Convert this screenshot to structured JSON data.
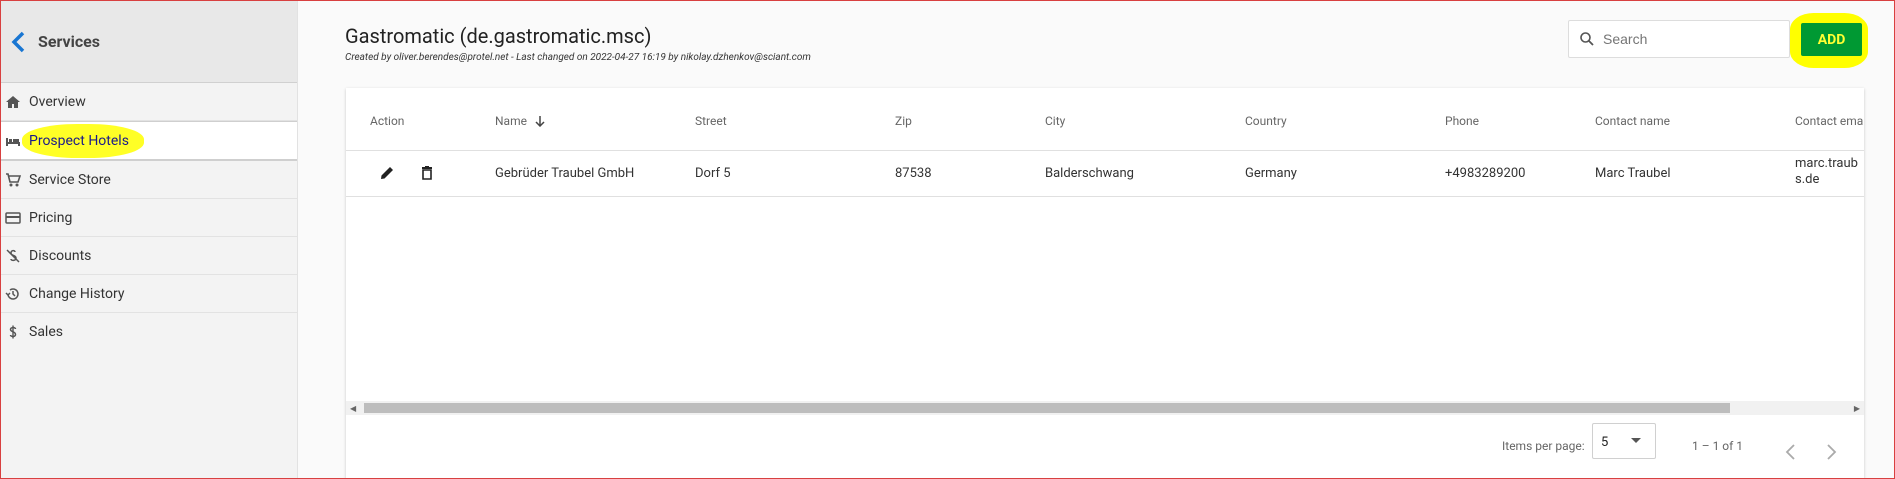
{
  "sidebar": {
    "title": "Services",
    "items": [
      {
        "label": "Overview"
      },
      {
        "label": "Prospect Hotels"
      },
      {
        "label": "Service Store"
      },
      {
        "label": "Pricing"
      },
      {
        "label": "Discounts"
      },
      {
        "label": "Change History"
      },
      {
        "label": "Sales"
      }
    ]
  },
  "header": {
    "title": "Gastromatic (de.gastromatic.msc)",
    "subtitle": "Created by oliver.berendes@protel.net - Last changed on 2022-04-27 16:19 by nikolay.dzhenkov@sciant.com",
    "search_placeholder": "Search",
    "add_label": "ADD"
  },
  "table": {
    "columns": [
      "Action",
      "Name",
      "Street",
      "Zip",
      "City",
      "Country",
      "Phone",
      "Contact name",
      "Contact ema"
    ],
    "rows": [
      {
        "name": "Gebrüder Traubel GmbH",
        "street": "Dorf 5",
        "zip": "87538",
        "city": "Balderschwang",
        "country": "Germany",
        "phone": "+4983289200",
        "contact_name": "Marc Traubel",
        "contact_email_line1": "marc.traub",
        "contact_email_line2": "s.de"
      }
    ]
  },
  "pager": {
    "items_per_page_label": "Items per page:",
    "items_per_page": "5",
    "range": "1 – 1 of 1"
  },
  "colors": {
    "add_button": "#009933",
    "highlight": "#ffff00"
  },
  "icons": [
    "chevron-left-icon",
    "home-icon",
    "bed-icon",
    "cart-icon",
    "credit-card-icon",
    "discount-icon",
    "history-icon",
    "dollar-icon",
    "search-icon",
    "sort-down-icon",
    "edit-icon",
    "delete-icon",
    "dropdown-icon",
    "chevron-left-icon",
    "chevron-right-icon"
  ]
}
